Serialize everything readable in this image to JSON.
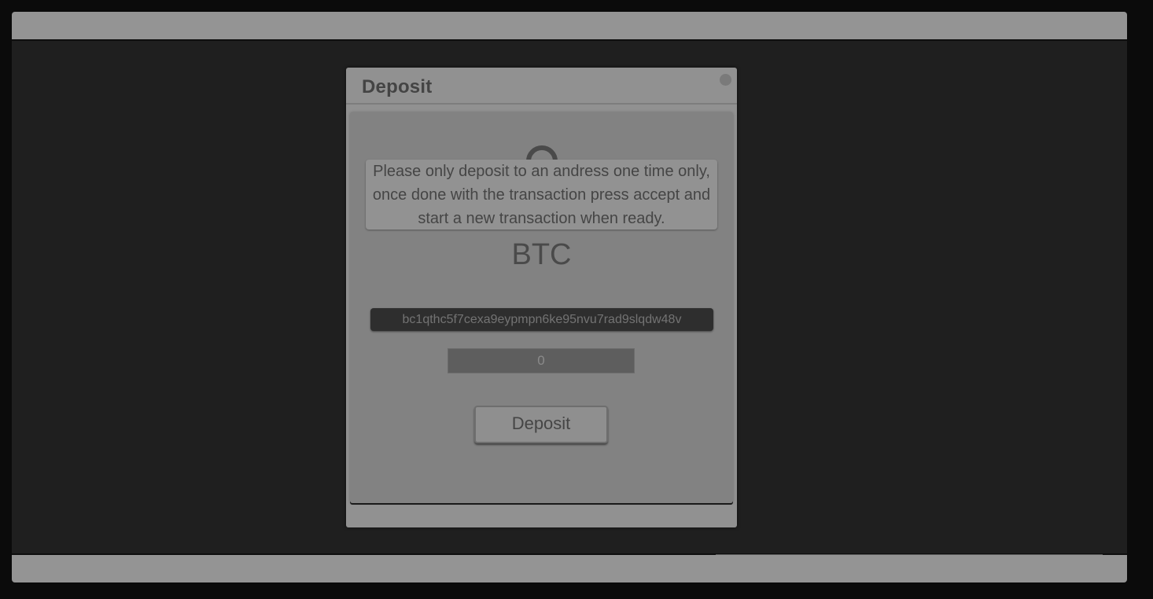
{
  "modal": {
    "title": "Deposit",
    "notice": "Please only deposit to an andress one time only, once done with the transaction press accept and start a new transaction when ready.",
    "coin": "BTC",
    "address": "bc1qthc5f7cexa9eypmpn6ke95nvu7rad9slqdw48v",
    "amount": "0",
    "deposit_button_label": "Deposit",
    "coin_icon": "coin-circle-icon",
    "close_icon": "close-dot-icon"
  },
  "colors": {
    "overlay_dark": "#1f1f1f",
    "bar_gray": "#949494",
    "modal_bg": "#919191",
    "body_bg": "#828282",
    "address_bg": "#2e2e2e"
  }
}
